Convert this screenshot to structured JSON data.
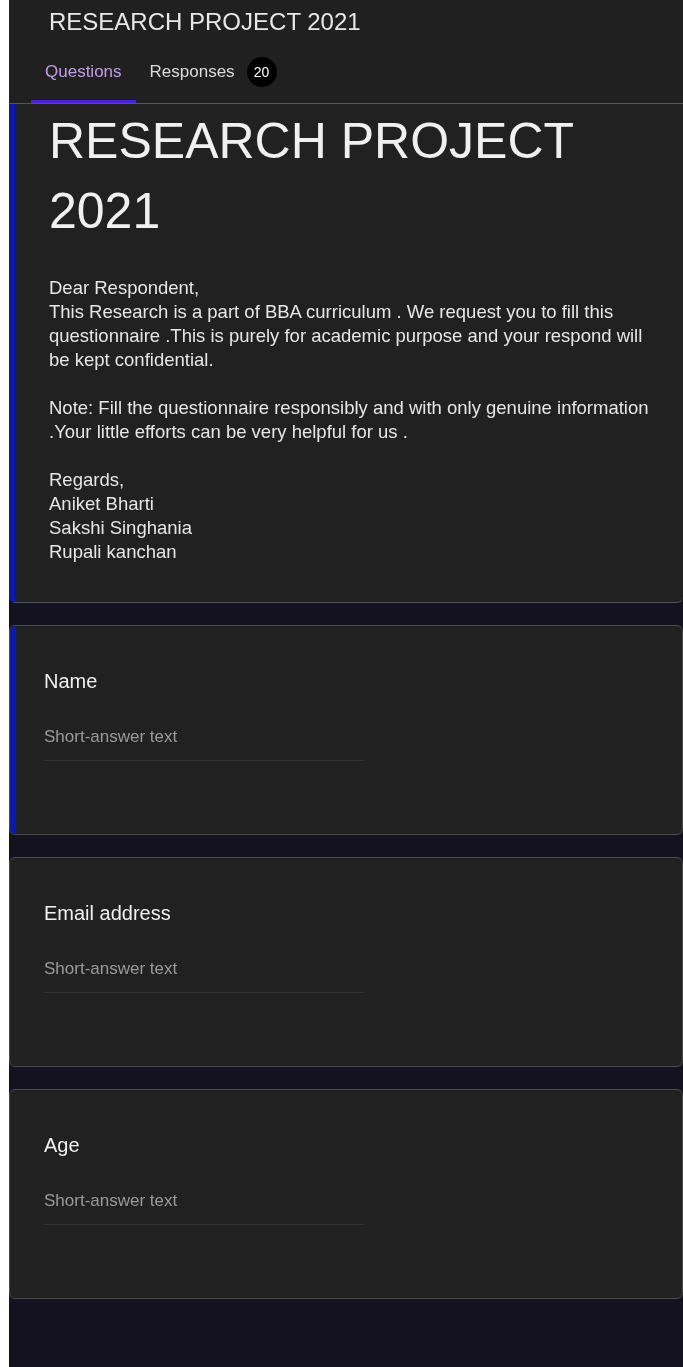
{
  "header": {
    "title": "RESEARCH PROJECT 2021"
  },
  "tabs": [
    {
      "label": "Questions",
      "selected": true
    },
    {
      "label": "Responses",
      "selected": false,
      "badge": "20"
    }
  ],
  "form": {
    "title": "RESEARCH PROJECT 2021",
    "highlighted": true,
    "description": [
      "Dear Respondent,\nThis Research is a part of BBA curriculum . We request you to fill this questionnaire .This is purely for academic purpose  and your respond will be kept confidential.",
      "Note: Fill the questionnaire responsibly and with only genuine information .Your little efforts can be very helpful for us .",
      "Regards,\nAniket Bharti\nSakshi Singhania\nRupali kanchan"
    ]
  },
  "questions": [
    {
      "title": "Name",
      "placeholder": "Short-answer text",
      "highlighted": true
    },
    {
      "title": "Email address",
      "placeholder": "Short-answer text",
      "highlighted": false
    },
    {
      "title": "Age",
      "placeholder": "Short-answer text",
      "highlighted": false
    }
  ]
}
